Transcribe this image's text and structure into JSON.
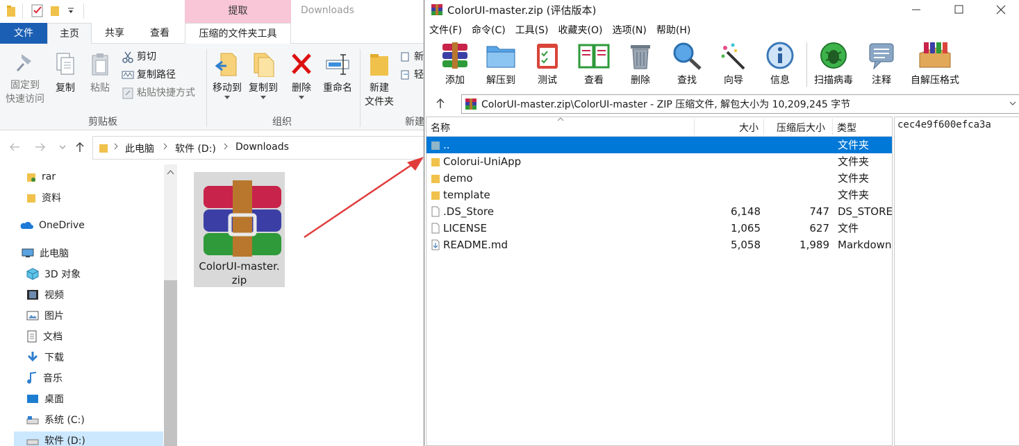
{
  "explorer": {
    "context_tab": "提取",
    "window_title": "Downloads",
    "tabs": [
      "文件",
      "主页",
      "共享",
      "查看",
      "压缩的文件夹工具"
    ],
    "ribbon": {
      "pin": "固定到\n快速访问",
      "copy": "复制",
      "paste": "粘贴",
      "cut": "剪切",
      "copy_path": "复制路径",
      "paste_shortcut": "粘贴快捷方式",
      "move_to": "移动到",
      "copy_to": "复制到",
      "delete": "删除",
      "rename": "重命名",
      "new_folder": "新建\n文件夹",
      "new_partial": "新",
      "easy_partial": "轻",
      "group_clipboard": "剪贴板",
      "group_organize": "组织",
      "group_new": "新建"
    },
    "breadcrumb": [
      "此电脑",
      "软件 (D:)",
      "Downloads"
    ],
    "nav": [
      {
        "label": "rar",
        "icon": "folder-icon"
      },
      {
        "label": "资料",
        "icon": "folder-icon"
      },
      {
        "label": "OneDrive",
        "icon": "cloud-icon"
      },
      {
        "label": "此电脑",
        "icon": "computer-icon"
      },
      {
        "label": "3D 对象",
        "icon": "cube-icon"
      },
      {
        "label": "视频",
        "icon": "video-icon"
      },
      {
        "label": "图片",
        "icon": "picture-icon"
      },
      {
        "label": "文档",
        "icon": "document-icon"
      },
      {
        "label": "下载",
        "icon": "download-icon"
      },
      {
        "label": "音乐",
        "icon": "music-icon"
      },
      {
        "label": "桌面",
        "icon": "desktop-icon"
      },
      {
        "label": "系统 (C:)",
        "icon": "drive-icon"
      },
      {
        "label": "软件 (D:)",
        "icon": "drive-icon"
      }
    ],
    "file_tile": {
      "name_line1": "ColorUI-master.",
      "name_line2": "zip"
    }
  },
  "winrar": {
    "title": "ColorUI-master.zip (评估版本)",
    "menu": [
      "文件(F)",
      "命令(C)",
      "工具(S)",
      "收藏夹(O)",
      "选项(N)",
      "帮助(H)"
    ],
    "toolbar": [
      "添加",
      "解压到",
      "测试",
      "查看",
      "删除",
      "查找",
      "向导",
      "信息",
      "扫描病毒",
      "注释",
      "自解压格式"
    ],
    "path": "ColorUI-master.zip\\ColorUI-master - ZIP 压缩文件, 解包大小为 10,209,245 字节",
    "columns": {
      "name": "名称",
      "size": "大小",
      "packed": "压缩后大小",
      "type": "类型"
    },
    "rows": [
      {
        "name": "..",
        "size": "",
        "packed": "",
        "type": "文件夹",
        "icon": "parent-folder-icon",
        "selected": true
      },
      {
        "name": "Colorui-UniApp",
        "size": "",
        "packed": "",
        "type": "文件夹",
        "icon": "folder-icon"
      },
      {
        "name": "demo",
        "size": "",
        "packed": "",
        "type": "文件夹",
        "icon": "folder-icon"
      },
      {
        "name": "template",
        "size": "",
        "packed": "",
        "type": "文件夹",
        "icon": "folder-icon"
      },
      {
        "name": ".DS_Store",
        "size": "6,148",
        "packed": "747",
        "type": "DS_STORE",
        "icon": "file-icon"
      },
      {
        "name": "LICENSE",
        "size": "1,065",
        "packed": "627",
        "type": "文件",
        "icon": "file-icon"
      },
      {
        "name": "README.md",
        "size": "5,058",
        "packed": "1,989",
        "type": "Markdown",
        "icon": "markdown-file-icon"
      }
    ],
    "comment": "cec4e9f600efca3a"
  },
  "colors": {
    "accent": "#0078d7",
    "file_tab": "#1a5fb4",
    "context_tab": "#f8c6d6",
    "arrow": "#e03c3c"
  }
}
